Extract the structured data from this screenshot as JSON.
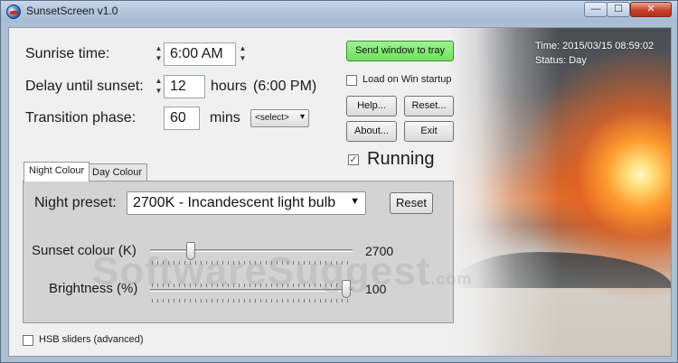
{
  "window": {
    "title": "SunsetScreen v1.0",
    "min_glyph": "—",
    "max_glyph": "☐",
    "close_glyph": "✕"
  },
  "status": {
    "time": "Time: 2015/03/15 08:59:02",
    "mode": "Status: Day"
  },
  "sunrise": {
    "label": "Sunrise time:",
    "value": "6:00 AM"
  },
  "delay": {
    "label": "Delay until sunset:",
    "value": "12",
    "unit": "hours",
    "sunset_time": "(6:00 PM)"
  },
  "transition": {
    "label": "Transition phase:",
    "value": "60",
    "unit": "mins",
    "select_value": "<select>"
  },
  "buttons": {
    "send_tray": "Send window to tray",
    "help": "Help...",
    "reset": "Reset...",
    "about": "About...",
    "exit": "Exit"
  },
  "load_on_startup": {
    "label": "Load on Win startup",
    "checked": false
  },
  "running": {
    "label": "Running",
    "checked": true,
    "check_glyph": "✓"
  },
  "tabs": {
    "night": "Night Colour",
    "day": "Day Colour"
  },
  "night_panel": {
    "preset_label": "Night preset:",
    "preset_value": "2700K - Incandescent light bulb",
    "reset_label": "Reset",
    "sunset_colour": {
      "label": "Sunset colour (K)",
      "value": "2700",
      "fraction": 0.18
    },
    "brightness": {
      "label": "Brightness (%)",
      "value": "100",
      "fraction": 1.0
    }
  },
  "hsb": {
    "label": "HSB sliders (advanced)",
    "checked": false
  },
  "watermark": {
    "main": "SoftwareSuggest",
    "suffix": ".com"
  },
  "colors": {
    "tray_button": "#7de86e",
    "title_gradient_top": "#c9d8ea",
    "close_button": "#c7432c"
  }
}
